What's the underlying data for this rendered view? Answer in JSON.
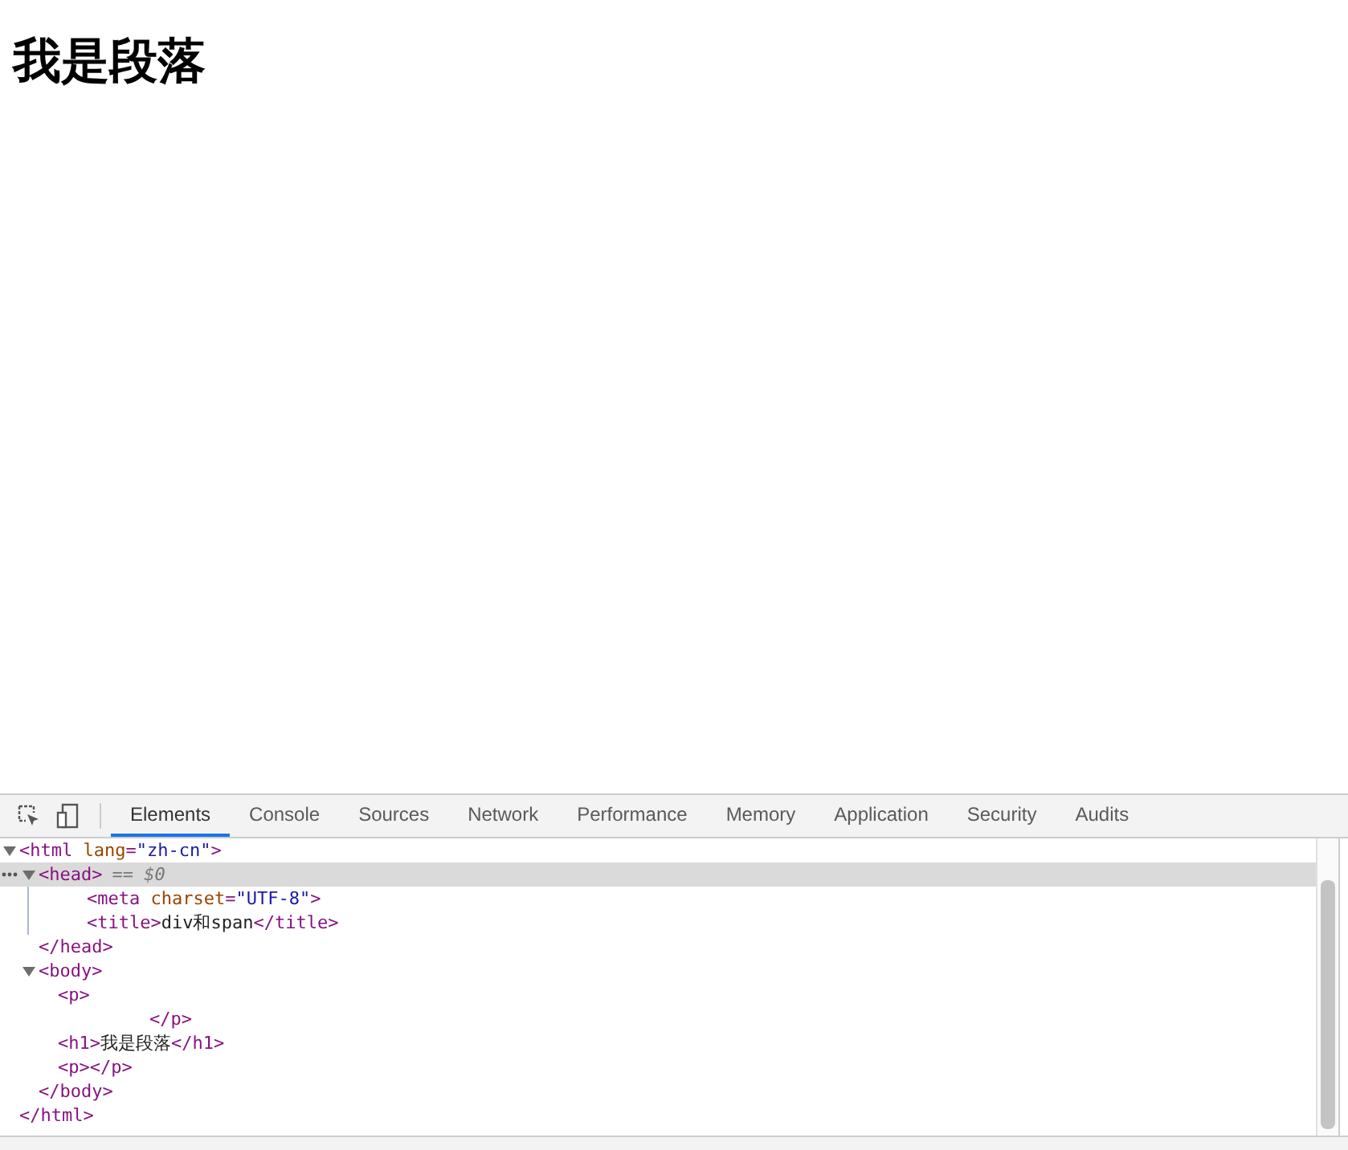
{
  "page": {
    "heading": "我是段落"
  },
  "devtools": {
    "tabs": [
      {
        "label": "Elements",
        "selected": true
      },
      {
        "label": "Console",
        "selected": false
      },
      {
        "label": "Sources",
        "selected": false
      },
      {
        "label": "Network",
        "selected": false
      },
      {
        "label": "Performance",
        "selected": false
      },
      {
        "label": "Memory",
        "selected": false
      },
      {
        "label": "Application",
        "selected": false
      },
      {
        "label": "Security",
        "selected": false
      },
      {
        "label": "Audits",
        "selected": false
      }
    ],
    "tree": [
      {
        "open": [
          {
            "kind": "tag",
            "text": "<html "
          },
          {
            "kind": "attr",
            "text": "lang"
          },
          {
            "kind": "tag",
            "text": "="
          },
          {
            "kind": "value",
            "text": "\"zh-cn\""
          },
          {
            "kind": "tag",
            "text": ">"
          }
        ],
        "expanded": true,
        "selected": false,
        "children": [
          {
            "open": [
              {
                "kind": "tag",
                "text": "<head>"
              },
              {
                "kind": "marker",
                "text": "== $0"
              }
            ],
            "expanded": true,
            "selected": true,
            "children": [
              {
                "open": [
                  {
                    "kind": "tag",
                    "text": "<meta "
                  },
                  {
                    "kind": "attr",
                    "text": "charset"
                  },
                  {
                    "kind": "tag",
                    "text": "="
                  },
                  {
                    "kind": "value",
                    "text": "\"UTF-8\""
                  },
                  {
                    "kind": "tag",
                    "text": ">"
                  }
                ],
                "selected": false
              },
              {
                "open": [
                  {
                    "kind": "tag",
                    "text": "<title>"
                  },
                  {
                    "kind": "text",
                    "text": "div和span"
                  },
                  {
                    "kind": "tag",
                    "text": "</title>"
                  }
                ],
                "selected": false
              }
            ],
            "close": [
              {
                "kind": "tag",
                "text": "</head>"
              }
            ]
          },
          {
            "open": [
              {
                "kind": "tag",
                "text": "<body>"
              }
            ],
            "expanded": true,
            "selected": false,
            "children": [
              {
                "open": [
                  {
                    "kind": "tag",
                    "text": "<p>"
                  }
                ],
                "selected": false,
                "close": [
                  {
                    "kind": "tag",
                    "text": "</p>"
                  }
                ],
                "close_wrapped": true
              },
              {
                "open": [
                  {
                    "kind": "tag",
                    "text": "<h1>"
                  },
                  {
                    "kind": "text",
                    "text": "我是段落"
                  },
                  {
                    "kind": "tag",
                    "text": "</h1>"
                  }
                ],
                "selected": false
              },
              {
                "open": [
                  {
                    "kind": "tag",
                    "text": "<p></p>"
                  }
                ],
                "selected": false
              }
            ],
            "close": [
              {
                "kind": "tag",
                "text": "</body>"
              }
            ]
          }
        ],
        "close": [
          {
            "kind": "tag",
            "text": "</html>"
          }
        ]
      }
    ]
  }
}
